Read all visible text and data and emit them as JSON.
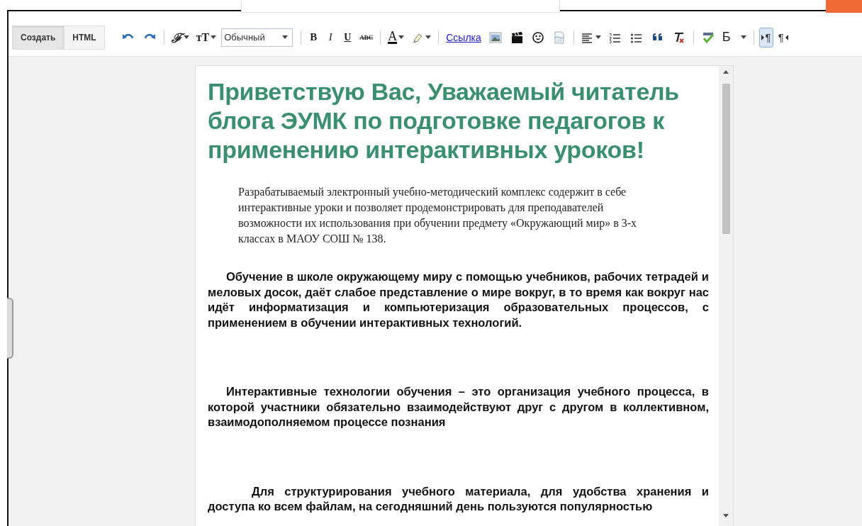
{
  "modes": [
    {
      "label": "Создать",
      "selected": true
    },
    {
      "label": "HTML",
      "selected": false
    }
  ],
  "toolbar": [
    {
      "kind": "undo"
    },
    {
      "kind": "redo"
    },
    {
      "kind": "sep"
    },
    {
      "kind": "font",
      "label": "ℱ"
    },
    {
      "kind": "size",
      "label": "тT"
    },
    {
      "kind": "select",
      "value": "Обычный"
    },
    {
      "kind": "sep"
    },
    {
      "kind": "bold",
      "label": "B"
    },
    {
      "kind": "italic",
      "label": "I"
    },
    {
      "kind": "underline",
      "label": "U"
    },
    {
      "kind": "strike",
      "label": "ABC"
    },
    {
      "kind": "sep"
    },
    {
      "kind": "color",
      "label": "A"
    },
    {
      "kind": "highlight"
    },
    {
      "kind": "sep"
    },
    {
      "kind": "link",
      "label": "Ссылка"
    },
    {
      "kind": "image"
    },
    {
      "kind": "video"
    },
    {
      "kind": "emoji"
    },
    {
      "kind": "pagebreak"
    },
    {
      "kind": "sep"
    },
    {
      "kind": "align"
    },
    {
      "kind": "ol"
    },
    {
      "kind": "ul"
    },
    {
      "kind": "quote"
    },
    {
      "kind": "clear"
    },
    {
      "kind": "sep"
    },
    {
      "kind": "spell"
    },
    {
      "kind": "input",
      "label": "Б"
    },
    {
      "kind": "sep"
    },
    {
      "kind": "ltr",
      "label": "¶",
      "selected": true
    },
    {
      "kind": "rtl",
      "label": "¶",
      "selected": false
    }
  ],
  "document": {
    "heading": "Приветствую Вас, Уважаемый читатель блога ЭУМК по подготовке педагогов к применению интерактивных уроков!",
    "paragraphs": [
      {
        "kind": "intro",
        "text": "Разрабатываемый электронный учебно-методический комплекс содержит в себе интерактивные уроки и позволяет продемонстрировать для преподавателей возможности их использования при обучении предмету «Окружающий мир» в 3-х классах в МАОУ СОШ № 138."
      },
      {
        "kind": "body",
        "text": "Обучение в школе окружающему миру с помощью учебников, рабочих тетрадей и меловых досок, даёт слабое представление о мире вокруг, в то время как вокруг нас идёт информатизация и компьютеризация образовательных процессов, с применением в обучении интерактивных технологий."
      },
      {
        "kind": "body",
        "text": "Интерактивные технологии обучения – это организация учебного процесса, в которой участники обязательно взаимодействуют друг с другом в коллективном, взаимодополняемом процессе познания"
      },
      {
        "kind": "deep",
        "text": "Для структурирования учебного материала, для удобства хранения и доступа ко всем файлам, на сегодняшний день пользуются популярностью"
      }
    ]
  }
}
